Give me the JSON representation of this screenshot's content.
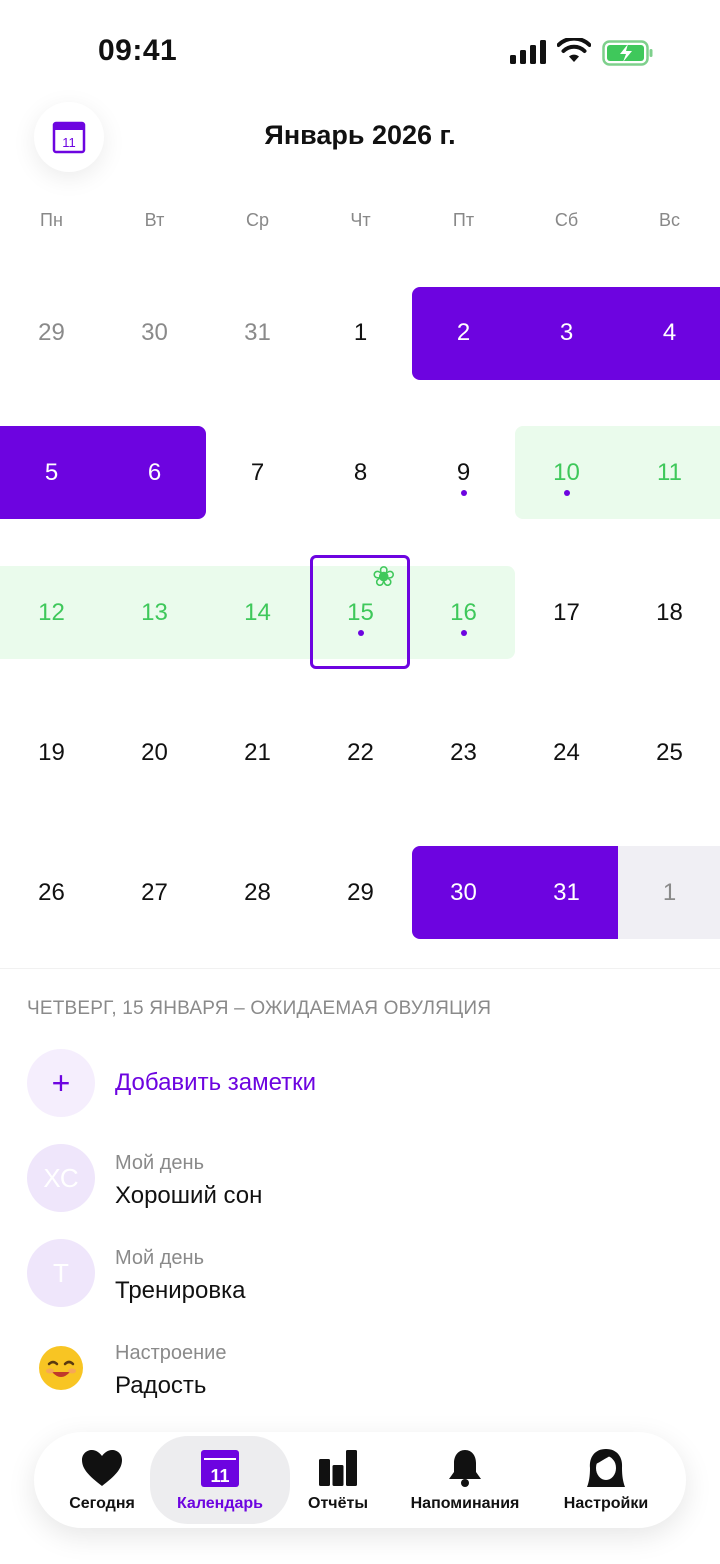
{
  "status_bar": {
    "time": "09:41"
  },
  "header": {
    "calendar_icon_day": "11",
    "month_title": "Январь 2026 г."
  },
  "weekdays": [
    "Пн",
    "Вт",
    "Ср",
    "Чт",
    "Пт",
    "Сб",
    "Вс"
  ],
  "calendar": {
    "weeks": [
      [
        {
          "d": "29",
          "state": "other-month"
        },
        {
          "d": "30",
          "state": "other-month"
        },
        {
          "d": "31",
          "state": "other-month"
        },
        {
          "d": "1",
          "state": "normal"
        },
        {
          "d": "2",
          "state": "period"
        },
        {
          "d": "3",
          "state": "period"
        },
        {
          "d": "4",
          "state": "period"
        }
      ],
      [
        {
          "d": "5",
          "state": "period"
        },
        {
          "d": "6",
          "state": "period"
        },
        {
          "d": "7",
          "state": "normal"
        },
        {
          "d": "8",
          "state": "normal"
        },
        {
          "d": "9",
          "state": "normal",
          "dot": true
        },
        {
          "d": "10",
          "state": "fertile",
          "dot": true
        },
        {
          "d": "11",
          "state": "fertile"
        }
      ],
      [
        {
          "d": "12",
          "state": "fertile"
        },
        {
          "d": "13",
          "state": "fertile"
        },
        {
          "d": "14",
          "state": "fertile"
        },
        {
          "d": "15",
          "state": "fertile",
          "dot": true,
          "selected": true,
          "ovulation": true
        },
        {
          "d": "16",
          "state": "fertile",
          "dot": true
        },
        {
          "d": "17",
          "state": "normal"
        },
        {
          "d": "18",
          "state": "normal"
        }
      ],
      [
        {
          "d": "19",
          "state": "normal"
        },
        {
          "d": "20",
          "state": "normal"
        },
        {
          "d": "21",
          "state": "normal"
        },
        {
          "d": "22",
          "state": "normal"
        },
        {
          "d": "23",
          "state": "normal"
        },
        {
          "d": "24",
          "state": "normal"
        },
        {
          "d": "25",
          "state": "normal"
        }
      ],
      [
        {
          "d": "26",
          "state": "normal"
        },
        {
          "d": "27",
          "state": "normal"
        },
        {
          "d": "28",
          "state": "normal"
        },
        {
          "d": "29",
          "state": "normal"
        },
        {
          "d": "30",
          "state": "period"
        },
        {
          "d": "31",
          "state": "period"
        },
        {
          "d": "1",
          "state": "other-month-predicted"
        }
      ]
    ],
    "ovulation_icon": "flower-icon"
  },
  "details": {
    "title": "ЧЕТВЕРГ, 15 ЯНВАРЯ – ОЖИДАЕМАЯ ОВУЛЯЦИЯ",
    "add_notes": {
      "icon": "+",
      "label": "Добавить заметки"
    },
    "entries": [
      {
        "initials": "ХС",
        "category": "Мой день",
        "value": "Хороший сон"
      },
      {
        "initials": "Т",
        "category": "Мой день",
        "value": "Тренировка"
      },
      {
        "icon": "smiling-face-emoji",
        "category": "Настроение",
        "value": "Радость"
      }
    ]
  },
  "nav": {
    "today": "Сегодня",
    "calendar": "Календарь",
    "calendar_icon_day": "11",
    "reports": "Отчёты",
    "reminders": "Напоминания",
    "settings": "Настройки"
  },
  "colors": {
    "accent": "#6d04e0",
    "fertile_bg": "#eafbec",
    "fertile_text": "#3fc85b",
    "other_month_text": "#8a8a8a",
    "predicted_bg": "#f0eff4"
  }
}
